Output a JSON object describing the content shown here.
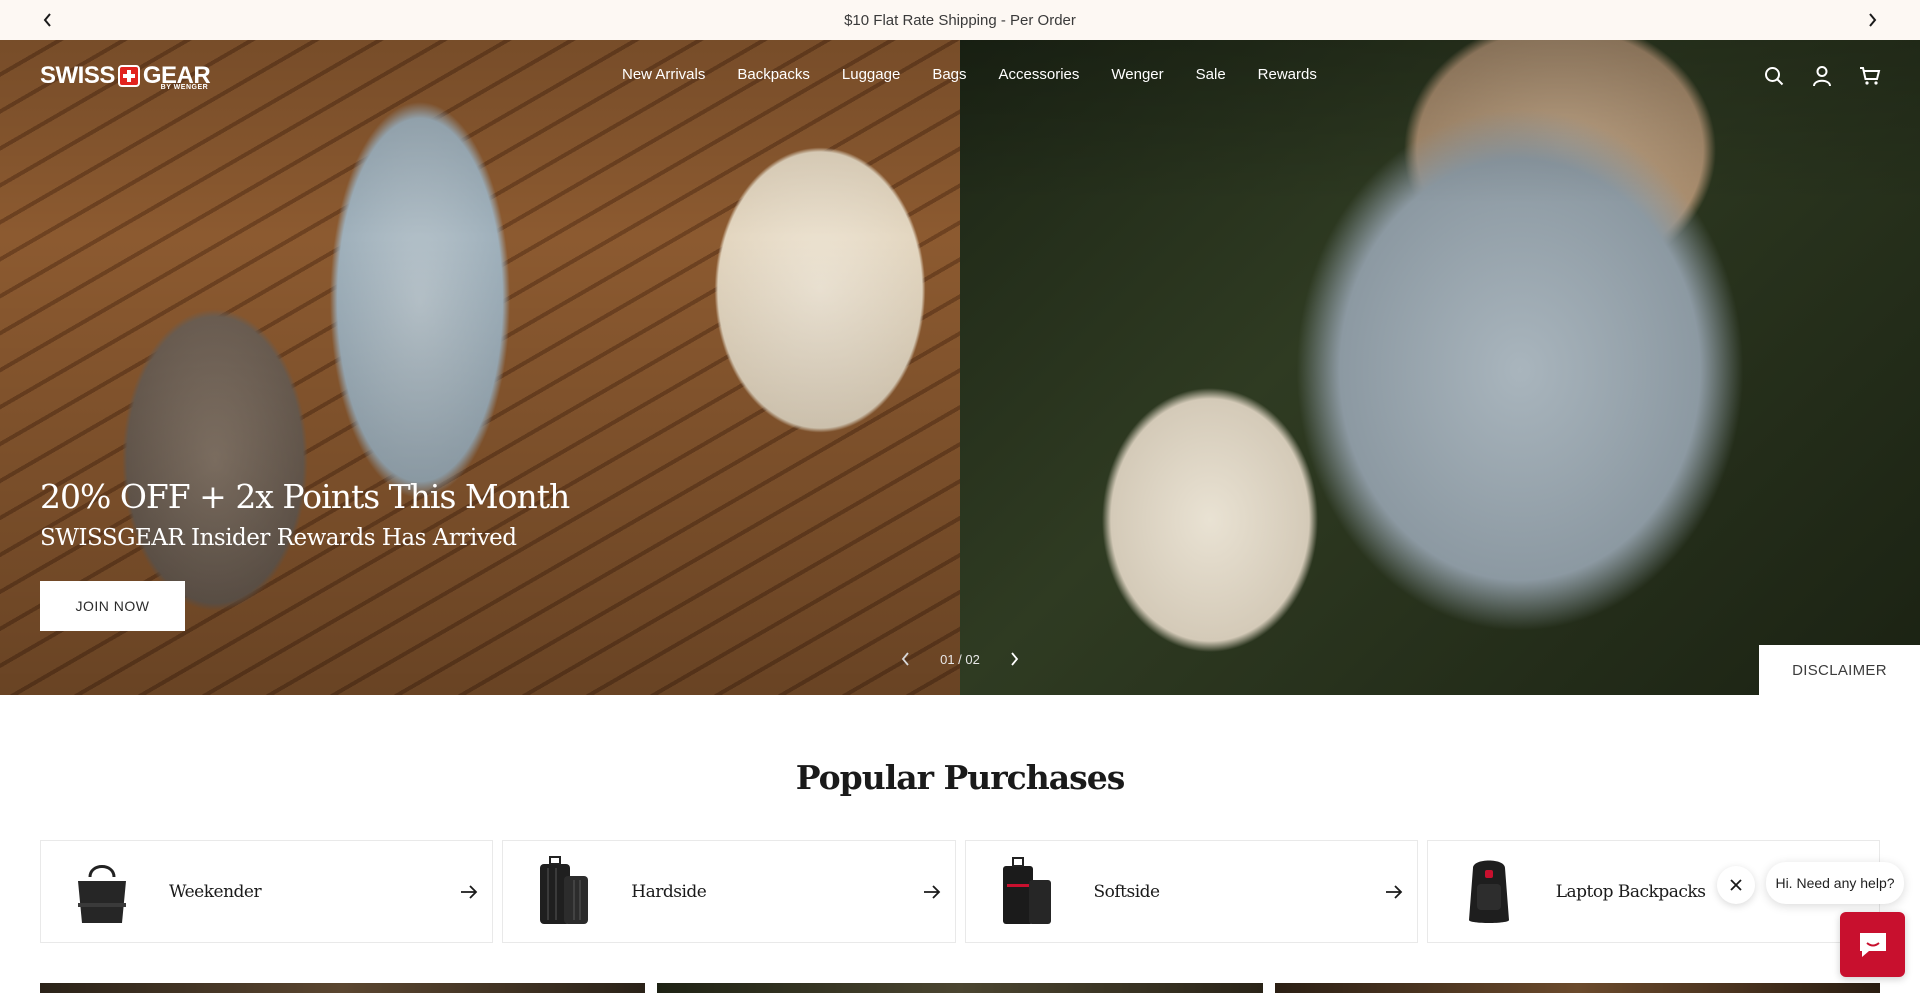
{
  "announcement": {
    "text": "$10 Flat Rate Shipping - Per Order",
    "prev_icon": "chevron-left-icon",
    "next_icon": "chevron-right-icon"
  },
  "header": {
    "logo_text_left": "SWISS",
    "logo_text_right": "GEAR",
    "logo_sub": "BY WENGER",
    "nav": [
      "New Arrivals",
      "Backpacks",
      "Luggage",
      "Bags",
      "Accessories",
      "Wenger",
      "Sale",
      "Rewards"
    ],
    "icons": [
      "search-icon",
      "account-icon",
      "cart-icon"
    ]
  },
  "hero": {
    "title": "20% OFF + 2x Points This Month",
    "subtitle": "SWISSGEAR Insider Rewards Has Arrived",
    "cta": "JOIN NOW",
    "pager": "01 / 02",
    "disclaimer": "DISCLAIMER"
  },
  "popular": {
    "title": "Popular Purchases",
    "items": [
      {
        "label": "Weekender",
        "icon": "arrow-right-icon"
      },
      {
        "label": "Hardside",
        "icon": "arrow-right-icon"
      },
      {
        "label": "Softside",
        "icon": "arrow-right-icon"
      },
      {
        "label": "Laptop Backpacks",
        "icon": "arrow-right-icon"
      }
    ]
  },
  "chat": {
    "greeting": "Hi. Need any help?"
  },
  "colors": {
    "announcement_bg": "#fdf8f3",
    "brand_red": "#c8102e",
    "logo_red": "#e1241f"
  }
}
